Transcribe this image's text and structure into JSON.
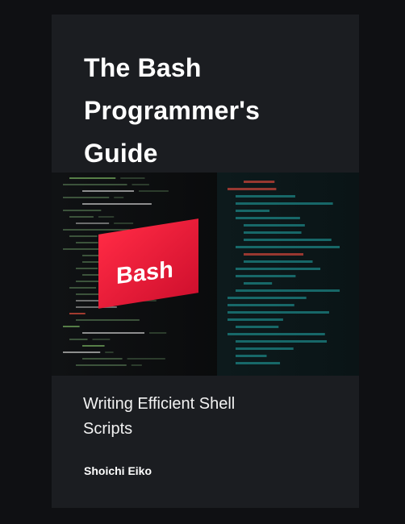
{
  "book": {
    "title_lines": [
      "The Bash",
      "Programmer's",
      "Guide"
    ],
    "subtitle_lines": [
      "Writing Efficient Shell",
      "Scripts"
    ],
    "author": "Shoichi Eiko"
  },
  "image": {
    "label": "Bash",
    "highlight_color": "#e8193a",
    "left_code_color": "#4c6a4a",
    "right_code_color": "#1c8a8a"
  },
  "colors": {
    "background": "#0f1013",
    "cover": "#1b1d21",
    "text": "#ffffff"
  }
}
